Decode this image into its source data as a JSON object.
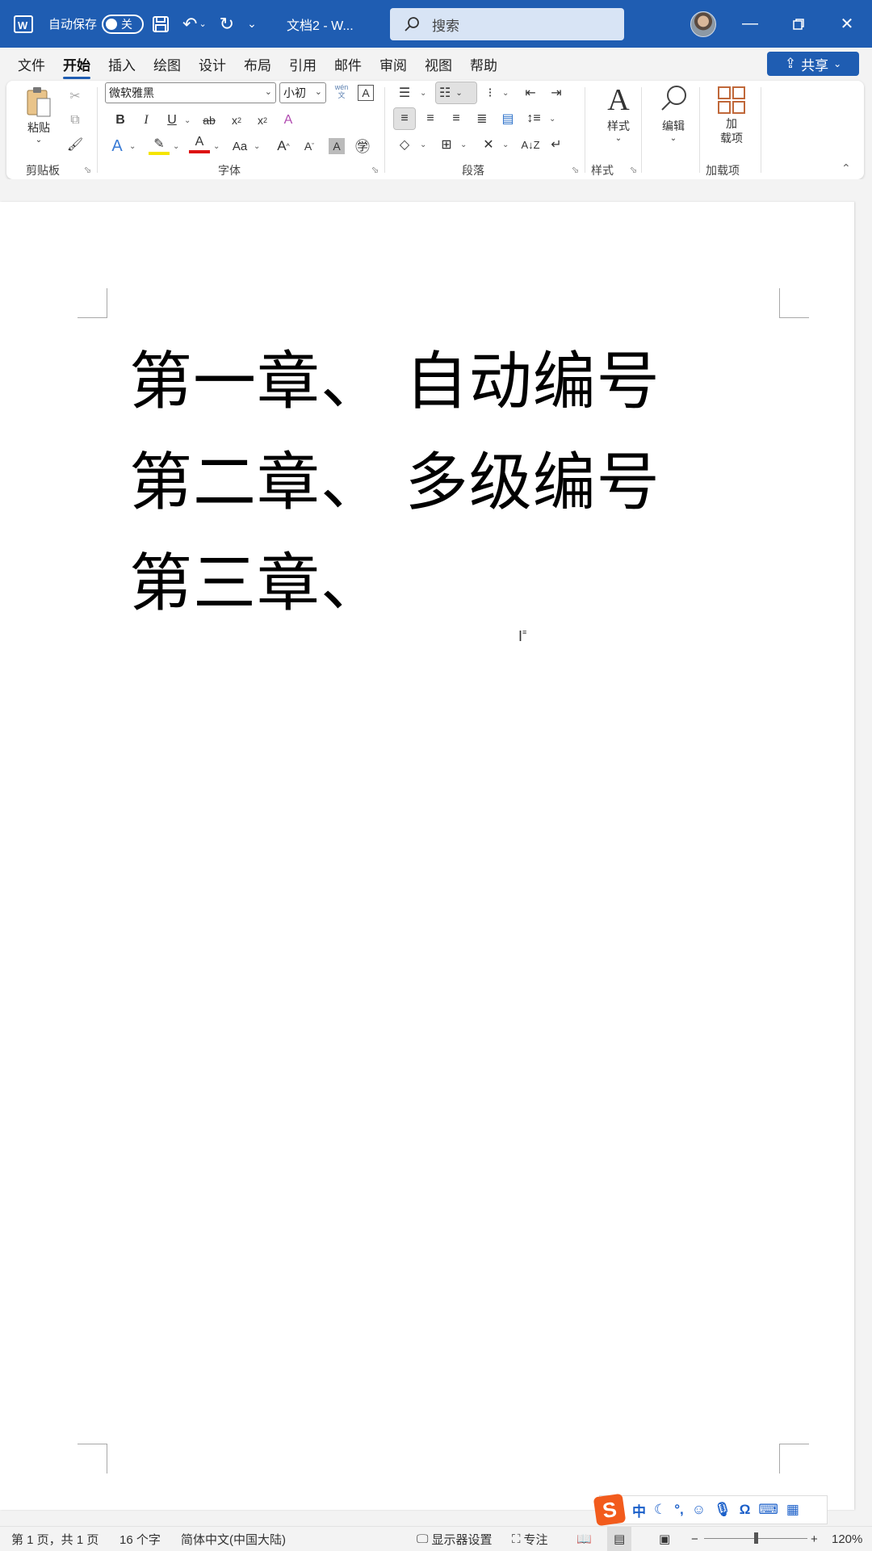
{
  "app": {
    "autosave_label": "自动保存",
    "autosave_state": "关",
    "doc_title": "文档2 - W...",
    "search_placeholder": "搜索",
    "accent_color": "#1f5db2"
  },
  "tabs": [
    "文件",
    "开始",
    "插入",
    "绘图",
    "设计",
    "布局",
    "引用",
    "邮件",
    "审阅",
    "视图",
    "帮助"
  ],
  "active_tab": "开始",
  "share_label": "共享",
  "ribbon": {
    "clipboard": {
      "paste": "粘贴",
      "group": "剪贴板"
    },
    "font": {
      "family": "微软雅黑",
      "size": "小初",
      "phonetic_top": "wén",
      "phonetic_bottom": "文",
      "group": "字体"
    },
    "paragraph": {
      "group": "段落"
    },
    "styles": {
      "label": "样式",
      "group": "样式"
    },
    "editing": {
      "label": "编辑"
    },
    "addins": {
      "label_line1": "加",
      "label_line2": "载项",
      "group": "加载项"
    }
  },
  "document": {
    "lines": [
      "第一章、 自动编号",
      "第二章、 多级编号",
      "第三章、"
    ]
  },
  "ime": {
    "mode": "中"
  },
  "status": {
    "page": "第 1 页，共 1 页",
    "words": "16 个字",
    "language": "简体中文(中国大陆)",
    "display_settings": "显示器设置",
    "focus": "专注",
    "zoom": "120%"
  }
}
